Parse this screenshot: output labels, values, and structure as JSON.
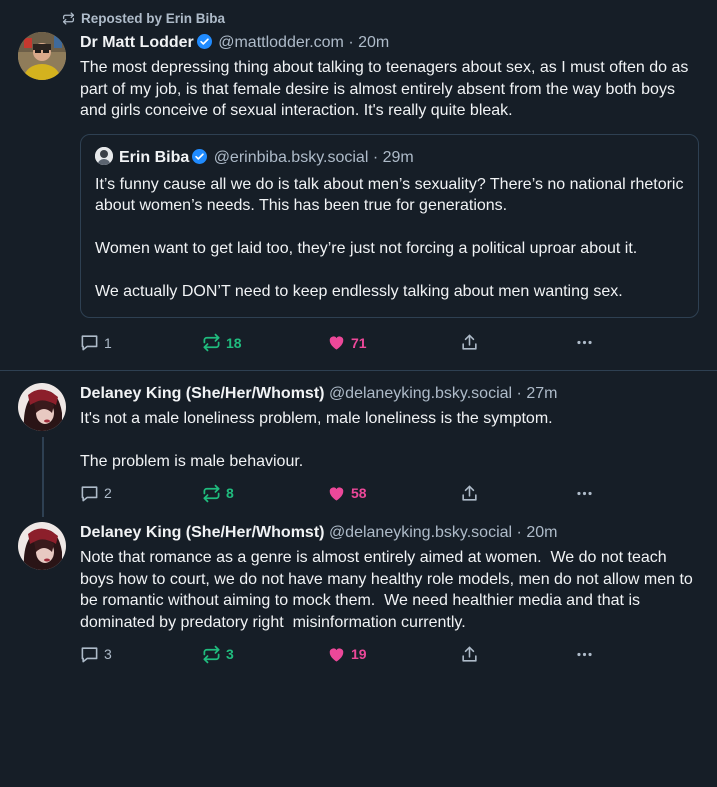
{
  "post1": {
    "repost_label": "Reposted by Erin Biba",
    "author_name": "Dr Matt Lodder",
    "author_handle": "@mattlodder.com",
    "time": "· 20m",
    "text": "The most depressing thing about talking to teenagers about sex, as I must often do as part of my job, is that female desire is almost entirely absent from the way both boys and girls conceive of sexual interaction. It's really quite bleak.",
    "quote": {
      "author_name": "Erin Biba",
      "author_handle": "@erinbiba.bsky.social",
      "time": "· 29m",
      "text": "It’s funny cause all we do is talk about men’s sexuality? There’s no national rhetoric about women’s needs. This has been true for generations.\n\nWomen want to get laid too, they’re just not forcing a political uproar about it.\n\nWe actually DON’T need to keep endlessly talking about men wanting sex."
    },
    "replies": "1",
    "reposts": "18",
    "likes": "71"
  },
  "post2": {
    "author_name": "Delaney King (She/Her/Whomst)",
    "author_handle": "@delaneyking.bsky.social",
    "time": "· 27m",
    "text": "It's not a male loneliness problem, male loneliness is the symptom.\n\nThe problem is male behaviour.",
    "replies": "2",
    "reposts": "8",
    "likes": "58"
  },
  "post3": {
    "author_name": "Delaney King (She/Her/Whomst)",
    "author_handle": "@delaneyking.bsky.social",
    "time": "· 20m",
    "text": "Note that romance as a genre is almost entirely aimed at women.  We do not teach boys how to court, we do not have many healthy role models, men do not allow men to be romantic without aiming to mock them.  We need healthier media and that is dominated by predatory right  misinformation currently.",
    "replies": "3",
    "reposts": "3",
    "likes": "19"
  },
  "colors": {
    "background": "#161e27",
    "repost_green": "#20bc7e",
    "like_pink": "#ec4899",
    "verified_blue": "#208bfe",
    "muted_text": "#aebbc9"
  },
  "icons": [
    "repost-icon",
    "verified-badge-icon",
    "reply-icon",
    "heart-icon",
    "share-icon",
    "more-icon"
  ]
}
